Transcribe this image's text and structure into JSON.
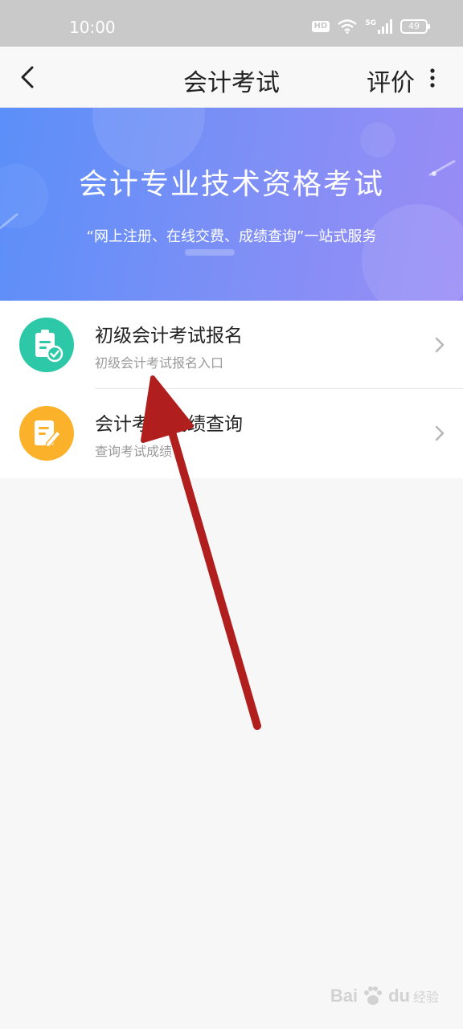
{
  "status_bar": {
    "time": "10:00",
    "hd_label": "HD",
    "network_label": "5G",
    "battery_level": "49",
    "icons": [
      "hd-icon",
      "wifi-icon",
      "signal-icon",
      "battery-icon"
    ]
  },
  "nav": {
    "back_icon": "chevron-left-icon",
    "title": "会计考试",
    "rate_label": "评价",
    "more_icon": "more-vertical-icon"
  },
  "banner": {
    "title": "会计专业技术资格考试",
    "subtitle": "“网上注册、在线交费、成绩查询”一站式服务",
    "gradient_colors": [
      "#5b8ff9",
      "#9a8cf5"
    ]
  },
  "list": {
    "items": [
      {
        "title": "初级会计考试报名",
        "subtitle": "初级会计考试报名入口",
        "icon": "clipboard-check-icon",
        "icon_color": "#2dc8a8"
      },
      {
        "title": "会计考试成绩查询",
        "subtitle": "查询考试成绩",
        "icon": "edit-document-icon",
        "icon_color": "#fbb22a"
      }
    ]
  },
  "annotation": {
    "arrow_color": "#b01e1e",
    "arrow_icon": "red-arrow-icon"
  },
  "watermark": {
    "brand": "Bai",
    "brand_suffix": "du",
    "subtext": "经验",
    "icon": "paw-icon"
  }
}
